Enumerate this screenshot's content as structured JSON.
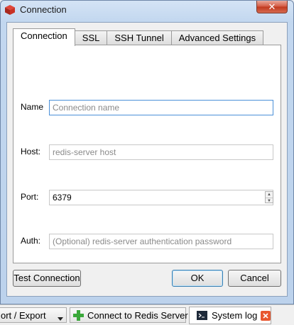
{
  "window": {
    "title": "Connection",
    "close_glyph": "✕"
  },
  "tabs": [
    {
      "label": "Connection",
      "active": true
    },
    {
      "label": "SSL",
      "active": false
    },
    {
      "label": "SSH Tunnel",
      "active": false
    },
    {
      "label": "Advanced Settings",
      "active": false
    }
  ],
  "form": {
    "name": {
      "label": "Name",
      "value": "",
      "placeholder": "Connection name"
    },
    "host": {
      "label": "Host:",
      "value": "",
      "placeholder": "redis-server host"
    },
    "port": {
      "label": "Port:",
      "value": "6379"
    },
    "auth": {
      "label": "Auth:",
      "value": "",
      "placeholder": "(Optional) redis-server authentication password"
    }
  },
  "buttons": {
    "test": "Test Connection",
    "ok": "OK",
    "cancel": "Cancel"
  },
  "taskbar": {
    "import_export": "ort / Export",
    "connect": "Connect to Redis Server",
    "system_log": "System log"
  },
  "icons": {
    "app": "redis-cube-icon",
    "dropdown": "chevron-down-icon",
    "connect": "plus-icon",
    "terminal": "terminal-icon",
    "close_tab": "close-icon"
  },
  "colors": {
    "accent_red": "#c0381d",
    "plus_green": "#3aa83a",
    "focus_blue": "#4a90d8"
  }
}
